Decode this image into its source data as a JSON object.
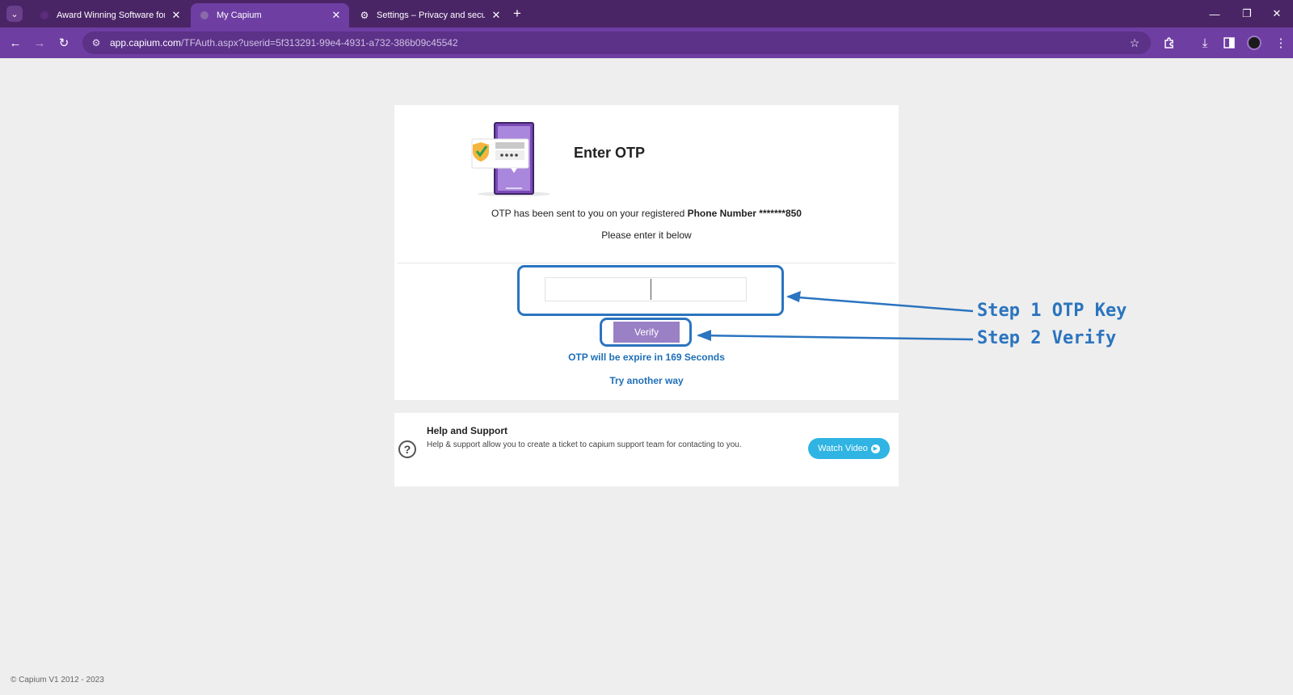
{
  "browser": {
    "tabs": [
      {
        "title": "Award Winning Software for Accountants",
        "icon": "capium-favicon",
        "active": false
      },
      {
        "title": "My Capium",
        "icon": "globe-icon",
        "active": true
      },
      {
        "title": "Settings – Privacy and security",
        "icon": "gear-icon",
        "active": false
      }
    ],
    "url_host": "app.capium.com",
    "url_path": "/TFAuth.aspx?userid=5f313291-99e4-4931-a732-386b09c45542",
    "accent_color": "#6e3ea3",
    "tabbar_color": "#4a2566"
  },
  "otp": {
    "title": "Enter OTP",
    "message_prefix": "OTP has been sent to you on your registered ",
    "message_bold": "Phone Number *******850",
    "message_2": "Please enter it below",
    "input_value": "",
    "verify_label": "Verify",
    "expire_text": "OTP will be expire in 169  Seconds",
    "try_another": "Try another way"
  },
  "help": {
    "title": "Help and Support",
    "description": "Help & support allow you to create a ticket to capium support team for contacting to you.",
    "watch_label": "Watch Video"
  },
  "footer": {
    "copyright": "© Capium V1 2012 - 2023"
  },
  "annotations": {
    "step1": "Step 1 OTP Key",
    "step2": "Step 2 Verify",
    "color": "#2b74bf"
  }
}
